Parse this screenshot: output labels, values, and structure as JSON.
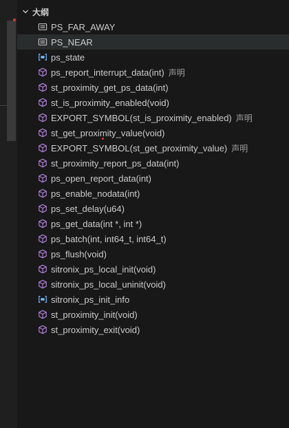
{
  "outline": {
    "title": "大纲",
    "items": [
      {
        "label": "PS_FAR_AWAY",
        "kind": "enum-member-icon",
        "desc": ""
      },
      {
        "label": "PS_NEAR",
        "kind": "enum-member-icon",
        "desc": "",
        "selected": true
      },
      {
        "label": "ps_state",
        "kind": "variable-icon",
        "desc": ""
      },
      {
        "label": "ps_report_interrupt_data(int)",
        "kind": "method-icon",
        "desc": "声明"
      },
      {
        "label": "st_proximity_get_ps_data(int)",
        "kind": "method-icon",
        "desc": ""
      },
      {
        "label": "st_is_proximity_enabled(void)",
        "kind": "method-icon",
        "desc": ""
      },
      {
        "label": "EXPORT_SYMBOL(st_is_proximity_enabled)",
        "kind": "method-icon",
        "desc": "声明"
      },
      {
        "label": "st_get_proximity_value(void)",
        "kind": "method-icon",
        "desc": ""
      },
      {
        "label": "EXPORT_SYMBOL(st_get_proximity_value)",
        "kind": "method-icon",
        "desc": "声明"
      },
      {
        "label": "st_proximity_report_ps_data(int)",
        "kind": "method-icon",
        "desc": ""
      },
      {
        "label": "ps_open_report_data(int)",
        "kind": "method-icon",
        "desc": ""
      },
      {
        "label": "ps_enable_nodata(int)",
        "kind": "method-icon",
        "desc": ""
      },
      {
        "label": "ps_set_delay(u64)",
        "kind": "method-icon",
        "desc": ""
      },
      {
        "label": "ps_get_data(int *, int *)",
        "kind": "method-icon",
        "desc": ""
      },
      {
        "label": "ps_batch(int, int64_t, int64_t)",
        "kind": "method-icon",
        "desc": ""
      },
      {
        "label": "ps_flush(void)",
        "kind": "method-icon",
        "desc": ""
      },
      {
        "label": "sitronix_ps_local_init(void)",
        "kind": "method-icon",
        "desc": ""
      },
      {
        "label": "sitronix_ps_local_uninit(void)",
        "kind": "method-icon",
        "desc": ""
      },
      {
        "label": "sitronix_ps_init_info",
        "kind": "variable-icon",
        "desc": ""
      },
      {
        "label": "st_proximity_init(void)",
        "kind": "method-icon",
        "desc": ""
      },
      {
        "label": "st_proximity_exit(void)",
        "kind": "method-icon",
        "desc": ""
      }
    ]
  },
  "colors": {
    "background": "#181818",
    "text": "#cccccc",
    "description": "#9d9d9d",
    "selected_row": "#2a2d2e",
    "method_icon": "#b180d7",
    "variable_icon": "#75beff",
    "enum_icon": "#cccccc",
    "cursor_marker": "#e0312b"
  }
}
